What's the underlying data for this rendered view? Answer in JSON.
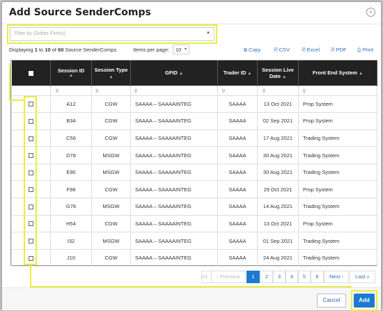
{
  "title": "Add Source SenderComps",
  "close_icon": "×",
  "filter": {
    "placeholder": "Filter by Globex Firm(s)"
  },
  "toolbar": {
    "display_prefix": "Displaying",
    "display_from": "1",
    "display_to_word": "to",
    "display_to": "10",
    "display_of_word": "of",
    "display_total": "60",
    "display_suffix": "Source SenderComps",
    "items_per_page_label": "Items per page:",
    "items_per_page_value": "10",
    "exports": [
      "Copy",
      "CSV",
      "Excel",
      "PDF",
      "Print"
    ]
  },
  "columns": {
    "session_id": "Session ID",
    "session_type": "Session Type",
    "gfid": "GFID",
    "trader_id": "Trader ID",
    "session_live_date": "Session Live Date",
    "front_end_system": "Front End System"
  },
  "rows": [
    {
      "session_id": "A12",
      "session_type": "CGW",
      "gfid": "SAAAA – SAAAAINTEG",
      "trader_id": "SAAAA",
      "live_date": "13 Oct 2021",
      "front_end": "Prop System"
    },
    {
      "session_id": "B34",
      "session_type": "CGW",
      "gfid": "SAAAA – SAAAAINTEG",
      "trader_id": "SAAAA",
      "live_date": "02 Sep 2021",
      "front_end": "Prop System"
    },
    {
      "session_id": "C56",
      "session_type": "CGW",
      "gfid": "SAAAA – SAAAAINTEG",
      "trader_id": "SAAAA",
      "live_date": "17 Aug 2021",
      "front_end": "Trading System"
    },
    {
      "session_id": "D78",
      "session_type": "MSGW",
      "gfid": "SAAAA – SAAAAINTEG",
      "trader_id": "SAAAA",
      "live_date": "30 Aug 2021",
      "front_end": "Trading System"
    },
    {
      "session_id": "E90",
      "session_type": "MSGW",
      "gfid": "SAAAA – SAAAAINTEG",
      "trader_id": "SAAAA",
      "live_date": "30 Aug 2021",
      "front_end": "Trading System"
    },
    {
      "session_id": "F98",
      "session_type": "CGW",
      "gfid": "SAAAA – SAAAAINTEG",
      "trader_id": "SAAAA",
      "live_date": "29 Oct 2021",
      "front_end": "Prop System"
    },
    {
      "session_id": "G76",
      "session_type": "MSGW",
      "gfid": "SAAAA – SAAAAINTEG",
      "trader_id": "SAAAA",
      "live_date": "14 Aug 2021",
      "front_end": "Trading System"
    },
    {
      "session_id": "H54",
      "session_type": "CGW",
      "gfid": "SAAAA – SAAAAINTEG",
      "trader_id": "SAAAA",
      "live_date": "13 Oct 2021",
      "front_end": "Prop System"
    },
    {
      "session_id": "I32",
      "session_type": "MSGW",
      "gfid": "SAAAA – SAAAAINTEG",
      "trader_id": "SAAAA",
      "live_date": "01 Sep 2021",
      "front_end": "Trading System"
    },
    {
      "session_id": "J10",
      "session_type": "CGW",
      "gfid": "SAAAA – SAAAAINTEG",
      "trader_id": "SAAAA",
      "live_date": "24 Aug 2021",
      "front_end": "Trading System"
    }
  ],
  "pagination": {
    "first": "First",
    "previous": "‹ Previous",
    "pages": [
      "1",
      "2",
      "3",
      "4",
      "5",
      "6"
    ],
    "current": "1",
    "next": "Next ›",
    "last": "Last »"
  },
  "footer": {
    "cancel": "Cancel",
    "add": "Add"
  },
  "colors": {
    "accent": "#1e7ad1",
    "highlight": "#e8ee3b",
    "header_bg": "#222222",
    "link": "#2a6ebb"
  }
}
